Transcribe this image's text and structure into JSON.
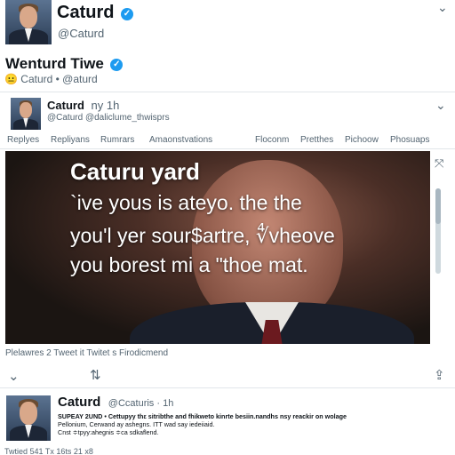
{
  "profile": {
    "name": "Caturd",
    "handle": "@Caturd"
  },
  "tweet_header": {
    "title": "Wenturd Tiwe",
    "sub": "Caturd • @aturd",
    "emoji": "😐"
  },
  "card": {
    "name": "Caturd",
    "time": "ny 1h",
    "handle": "@Caturd @daliclume_thwisprs"
  },
  "tabs": [
    "Replyes",
    "Repliyans",
    "Rumrars",
    "Amaonstvations",
    "Floconm",
    "Pretthes",
    "Pichoow",
    "Phosuaps"
  ],
  "video": {
    "title": "Caturu yard",
    "lines": [
      "`ive yous is  ateyo. the  the",
      "you'l yer sour$artre, ∜vheove",
      "you borest mi a \"thoe mat."
    ]
  },
  "stats": "Plelawres 2 Tweet it  Twitet s  Firodicmend",
  "second_tweet": {
    "name": "Caturd",
    "meta": "@Ccaturis · 1h",
    "line1": "SUPEAY 2UND • Cettupyy thε sitribthe and fhikweto kinrte besiin.nandhs nsy reackir on wolage",
    "line2": "Pellonium, Cerwand ay ashegns. ITT wad say iedeiiaid.",
    "line3": "Cnst ≑tpyy:ahegnis ≑ca sdkaflend."
  },
  "bottom_line": "Twtied 541 Tx 16ts 21 x8",
  "icons": {
    "verified": "✓",
    "chevron": "⌄",
    "retweet": "⇅",
    "share": "⇪",
    "close": "⤧"
  }
}
